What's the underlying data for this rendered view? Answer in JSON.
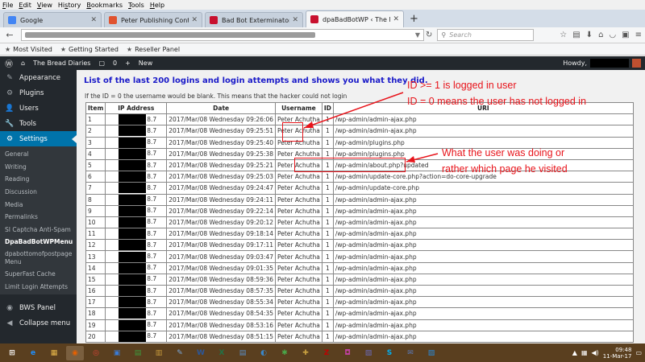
{
  "browser": {
    "menu": [
      {
        "pre": "",
        "key": "F",
        "post": "ile"
      },
      {
        "pre": "",
        "key": "E",
        "post": "dit"
      },
      {
        "pre": "",
        "key": "V",
        "post": "iew"
      },
      {
        "pre": "Hi",
        "key": "s",
        "post": "tory"
      },
      {
        "pre": "",
        "key": "B",
        "post": "ookmarks"
      },
      {
        "pre": "",
        "key": "T",
        "post": "ools"
      },
      {
        "pre": "",
        "key": "H",
        "post": "elp"
      }
    ],
    "tabs": [
      {
        "label": "Google",
        "favicon_color": "#4285f4",
        "active": false
      },
      {
        "label": "Peter Publishing Control P...",
        "favicon_color": "#e0532f",
        "active": false
      },
      {
        "label": "Bad Bot Exterminator",
        "favicon_color": "#c8102e",
        "active": false
      },
      {
        "label": "dpaBadBotWP ‹ The Bread...",
        "favicon_color": "#c8102e",
        "active": true
      }
    ],
    "search_placeholder": "Search",
    "bookmarks": [
      "Most Visited",
      "Getting Started",
      "Reseller Panel"
    ]
  },
  "adminbar": {
    "site_name": "The Bread Diaries",
    "comments_count": "0",
    "new_label": "New",
    "howdy": "Howdy,"
  },
  "sidebar": {
    "items_top": [
      {
        "label": "Appearance",
        "icon": "paintbrush-icon",
        "glyph": "✎"
      },
      {
        "label": "Plugins",
        "icon": "plugin-icon",
        "glyph": "⚙"
      },
      {
        "label": "Users",
        "icon": "users-icon",
        "glyph": "👤"
      },
      {
        "label": "Tools",
        "icon": "wrench-icon",
        "glyph": "🔧"
      },
      {
        "label": "Settings",
        "icon": "settings-icon",
        "glyph": "⚙",
        "current": true
      }
    ],
    "submenu": [
      {
        "label": "General"
      },
      {
        "label": "Writing"
      },
      {
        "label": "Reading"
      },
      {
        "label": "Discussion"
      },
      {
        "label": "Media"
      },
      {
        "label": "Permalinks"
      },
      {
        "label": "SI Captcha Anti-Spam"
      },
      {
        "label": "DpaBadBotWPMenu",
        "bold": true
      },
      {
        "label": "dpabottomofpostpage Menu",
        "tall": true
      },
      {
        "label": "SuperFast Cache"
      },
      {
        "label": "Limit Login Attempts"
      }
    ],
    "items_bottom": [
      {
        "label": "BWS Panel",
        "icon": "bws-panel-icon",
        "glyph": "◉"
      },
      {
        "label": "Collapse menu",
        "icon": "collapse-icon",
        "glyph": "◀"
      }
    ]
  },
  "content": {
    "heading": "List of the last 200 logins and login attempts and shows you what they did.",
    "note": "If the ID = 0 the username would be blank. This means that the hacker could not login",
    "columns": [
      "Item",
      "IP Address",
      "Date",
      "Username",
      "ID",
      "URI"
    ],
    "rows": [
      {
        "item": "1",
        "ip": "8.7",
        "date": "2017/Mar/08 Wednesday 09:26:06",
        "user": "Peter Achutha",
        "id": "1",
        "uri": "/wp-admin/admin-ajax.php"
      },
      {
        "item": "2",
        "ip": "8.7",
        "date": "2017/Mar/08 Wednesday 09:25:51",
        "user": "Peter Achutha",
        "id": "1",
        "uri": "/wp-admin/admin-ajax.php"
      },
      {
        "item": "3",
        "ip": "8.7",
        "date": "2017/Mar/08 Wednesday 09:25:40",
        "user": "Peter Achutha",
        "id": "1",
        "uri": "/wp-admin/plugins.php"
      },
      {
        "item": "4",
        "ip": "8.7",
        "date": "2017/Mar/08 Wednesday 09:25:38",
        "user": "Peter Achutha",
        "id": "1",
        "uri": "/wp-admin/plugins.php"
      },
      {
        "item": "5",
        "ip": "8.7",
        "date": "2017/Mar/08 Wednesday 09:25:21",
        "user": "Peter Achutha",
        "id": "1",
        "uri": "/wp-admin/about.php?updated"
      },
      {
        "item": "6",
        "ip": "8.7",
        "date": "2017/Mar/08 Wednesday 09:25:03",
        "user": "Peter Achutha",
        "id": "1",
        "uri": "/wp-admin/update-core.php?action=do-core-upgrade"
      },
      {
        "item": "7",
        "ip": "8.7",
        "date": "2017/Mar/08 Wednesday 09:24:47",
        "user": "Peter Achutha",
        "id": "1",
        "uri": "/wp-admin/update-core.php"
      },
      {
        "item": "8",
        "ip": "8.7",
        "date": "2017/Mar/08 Wednesday 09:24:11",
        "user": "Peter Achutha",
        "id": "1",
        "uri": "/wp-admin/admin-ajax.php"
      },
      {
        "item": "9",
        "ip": "8.7",
        "date": "2017/Mar/08 Wednesday 09:22:14",
        "user": "Peter Achutha",
        "id": "1",
        "uri": "/wp-admin/admin-ajax.php"
      },
      {
        "item": "10",
        "ip": "8.7",
        "date": "2017/Mar/08 Wednesday 09:20:12",
        "user": "Peter Achutha",
        "id": "1",
        "uri": "/wp-admin/admin-ajax.php"
      },
      {
        "item": "11",
        "ip": "8.7",
        "date": "2017/Mar/08 Wednesday 09:18:14",
        "user": "Peter Achutha",
        "id": "1",
        "uri": "/wp-admin/admin-ajax.php"
      },
      {
        "item": "12",
        "ip": "8.7",
        "date": "2017/Mar/08 Wednesday 09:17:11",
        "user": "Peter Achutha",
        "id": "1",
        "uri": "/wp-admin/admin-ajax.php"
      },
      {
        "item": "13",
        "ip": "8.7",
        "date": "2017/Mar/08 Wednesday 09:03:47",
        "user": "Peter Achutha",
        "id": "1",
        "uri": "/wp-admin/admin-ajax.php"
      },
      {
        "item": "14",
        "ip": "8.7",
        "date": "2017/Mar/08 Wednesday 09:01:35",
        "user": "Peter Achutha",
        "id": "1",
        "uri": "/wp-admin/admin-ajax.php"
      },
      {
        "item": "15",
        "ip": "8.7",
        "date": "2017/Mar/08 Wednesday 08:59:36",
        "user": "Peter Achutha",
        "id": "1",
        "uri": "/wp-admin/admin-ajax.php"
      },
      {
        "item": "16",
        "ip": "8.7",
        "date": "2017/Mar/08 Wednesday 08:57:35",
        "user": "Peter Achutha",
        "id": "1",
        "uri": "/wp-admin/admin-ajax.php"
      },
      {
        "item": "17",
        "ip": "8.7",
        "date": "2017/Mar/08 Wednesday 08:55:34",
        "user": "Peter Achutha",
        "id": "1",
        "uri": "/wp-admin/admin-ajax.php"
      },
      {
        "item": "18",
        "ip": "8.7",
        "date": "2017/Mar/08 Wednesday 08:54:35",
        "user": "Peter Achutha",
        "id": "1",
        "uri": "/wp-admin/admin-ajax.php"
      },
      {
        "item": "19",
        "ip": "8.7",
        "date": "2017/Mar/08 Wednesday 08:53:16",
        "user": "Peter Achutha",
        "id": "1",
        "uri": "/wp-admin/admin-ajax.php"
      },
      {
        "item": "20",
        "ip": "8.7",
        "date": "2017/Mar/08 Wednesday 08:51:15",
        "user": "Peter Achutha",
        "id": "1",
        "uri": "/wp-admin/admin-ajax.php"
      }
    ]
  },
  "annotations": {
    "line1": "ID >= 1 is logged in user",
    "line2": "ID = 0 means the user has not logged in",
    "line3": "What the user was doing or",
    "line4": "rather which page he visited",
    "color": "#e8141b"
  },
  "taskbar": {
    "apps": [
      {
        "name": "ie-icon",
        "glyph": "e",
        "color": "#1e90ff"
      },
      {
        "name": "file-explorer-icon",
        "glyph": "▦",
        "color": "#e8b84a"
      },
      {
        "name": "firefox-icon",
        "glyph": "◉",
        "color": "#e66000",
        "active": true
      },
      {
        "name": "chrome-icon",
        "glyph": "◎",
        "color": "#db4437"
      },
      {
        "name": "desktop-icon",
        "glyph": "▣",
        "color": "#3a7bd5"
      },
      {
        "name": "store-icon",
        "glyph": "▤",
        "color": "#3c9a3c"
      },
      {
        "name": "folder-icon",
        "glyph": "▥",
        "color": "#c89b3c"
      },
      {
        "name": "notepad-icon",
        "glyph": "✎",
        "color": "#7aa7d8"
      },
      {
        "name": "word-icon",
        "glyph": "W",
        "color": "#2b579a"
      },
      {
        "name": "excel-icon",
        "glyph": "X",
        "color": "#217346"
      },
      {
        "name": "notepad2-icon",
        "glyph": "▤",
        "color": "#5a8fc8"
      },
      {
        "name": "media-icon",
        "glyph": "◐",
        "color": "#3a86c8"
      },
      {
        "name": "puzzle-icon",
        "glyph": "✱",
        "color": "#4aa84a"
      },
      {
        "name": "tools-icon",
        "glyph": "✚",
        "color": "#c8a040"
      },
      {
        "name": "filezilla-icon",
        "glyph": "Z",
        "color": "#bf0000"
      },
      {
        "name": "camera-icon",
        "glyph": "◘",
        "color": "#c040a0"
      },
      {
        "name": "network-icon",
        "glyph": "▧",
        "color": "#6a6ab8"
      },
      {
        "name": "skype-icon",
        "glyph": "S",
        "color": "#00aff0"
      },
      {
        "name": "mail-icon",
        "glyph": "✉",
        "color": "#5a7ab8"
      },
      {
        "name": "paint-icon",
        "glyph": "▨",
        "color": "#2a8ad8"
      }
    ],
    "time": "09:48",
    "date": "11-Mar-17"
  }
}
